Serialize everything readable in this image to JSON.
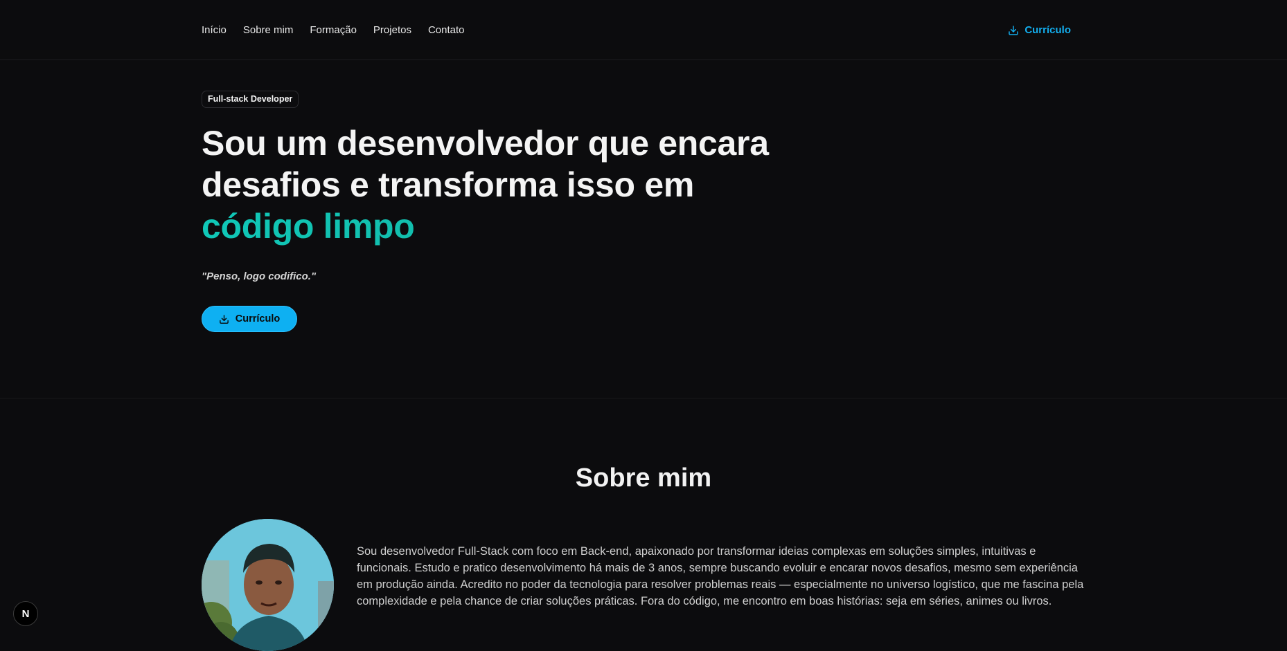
{
  "nav": {
    "links": [
      "Início",
      "Sobre mim",
      "Formação",
      "Projetos",
      "Contato"
    ],
    "cv_label": "Currículo"
  },
  "hero": {
    "badge": "Full-stack Developer",
    "headline_line1": "Sou um desenvolvedor que encara",
    "headline_line2": "desafios e transforma isso em",
    "headline_accent": "código limpo",
    "quote": "\"Penso, logo codifico.\"",
    "cv_label": "Currículo"
  },
  "about": {
    "title": "Sobre mim",
    "text": "Sou desenvolvedor Full-Stack com foco em Back-end, apaixonado por transformar ideias complexas em soluções simples, intuitivas e funcionais. Estudo e pratico desenvolvimento há mais de 3 anos, sempre buscando evoluir e encarar novos desafios, mesmo sem experiência em produção ainda. Acredito no poder da tecnologia para resolver problemas reais — especialmente no universo logístico, que me fascina pela complexidade e pela chance de criar soluções práticas. Fora do código, me encontro em boas histórias: seja em séries, animes ou livros."
  },
  "dev_indicator": {
    "label": "N"
  },
  "colors": {
    "background": "#0c0c0e",
    "accent_blue": "#0eb0f2",
    "accent_teal": "#14b8a6"
  },
  "icons": {
    "cv": "download-icon"
  }
}
